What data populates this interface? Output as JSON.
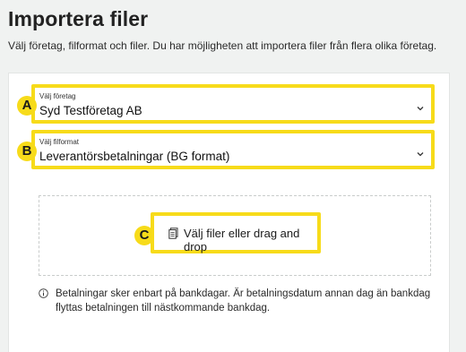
{
  "page": {
    "title": "Importera filer",
    "subtitle": "Välj företag, filformat och filer. Du har möjligheten att importera filer från flera olika företag."
  },
  "markers": {
    "a": "A",
    "b": "B",
    "c": "C"
  },
  "company_select": {
    "label": "Välj företag",
    "value": "Syd Testföretag AB",
    "icon": "chevron-down-icon"
  },
  "format_select": {
    "label": "Välj filformat",
    "value": "Leverantörsbetalningar (BG format)",
    "icon": "chevron-down-icon"
  },
  "upload": {
    "label": "Välj filer eller drag and drop",
    "icon": "file-icon"
  },
  "info": {
    "icon": "info-icon",
    "text": "Betalningar sker enbart på bankdagar. Är betalningsdatum annan dag än bankdag flyttas betalningen till nästkommande bankdag."
  },
  "colors": {
    "highlight": "#f7db1a",
    "background": "#f0f2f1",
    "card": "#ffffff"
  }
}
